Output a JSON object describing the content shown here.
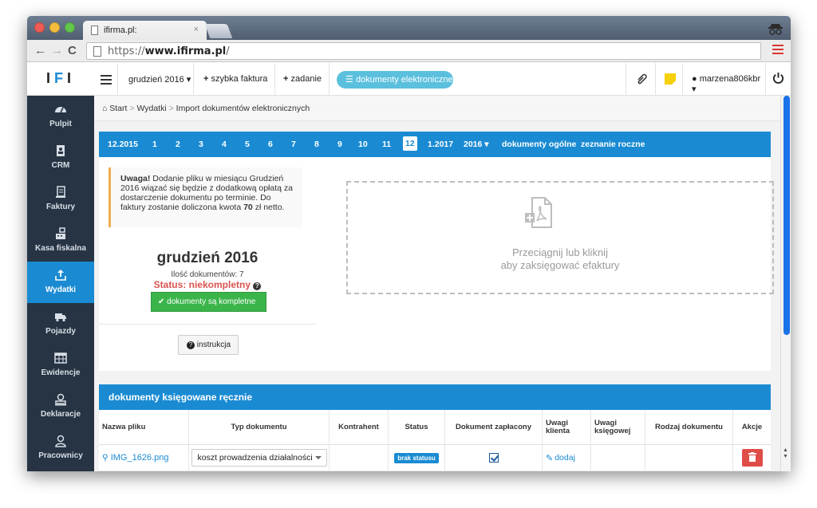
{
  "browser": {
    "tab_title": "ifirma.pl:",
    "tab_close": "×",
    "url_scheme": "https://",
    "url_host": "www.ifirma.pl",
    "url_path": "/"
  },
  "logo": {
    "text": "IFI"
  },
  "sidebar": {
    "items": [
      {
        "label": "Pulpit",
        "icon": "dashboard-icon"
      },
      {
        "label": "CRM",
        "icon": "contacts-icon"
      },
      {
        "label": "Faktury",
        "icon": "invoice-icon"
      },
      {
        "label": "Kasa fiskalna",
        "icon": "cash-register-icon"
      },
      {
        "label": "Wydatki",
        "icon": "upload-icon",
        "active": true
      },
      {
        "label": "Pojazdy",
        "icon": "truck-icon"
      },
      {
        "label": "Ewidencje",
        "icon": "table-icon"
      },
      {
        "label": "Deklaracje",
        "icon": "stamp-icon"
      },
      {
        "label": "Pracownicy",
        "icon": "person-icon"
      }
    ]
  },
  "appbar": {
    "month": "grudzień 2016",
    "quick_invoice": "szybka faktura",
    "task": "zadanie",
    "edocs": "dokumenty elektroniczne",
    "user": "marzena806kbr"
  },
  "breadcrumb": {
    "start": "Start",
    "expenses": "Wydatki",
    "current": "Import dokumentów elektronicznych"
  },
  "months": [
    "12.2015",
    "1",
    "2",
    "3",
    "4",
    "5",
    "6",
    "7",
    "8",
    "9",
    "10",
    "11",
    "12",
    "1.2017",
    "2016",
    "dokumenty ogólne",
    "zeznanie roczne"
  ],
  "warning": {
    "bold": "Uwaga!",
    "text1": " Dodanie pliku w miesiącu Grudzień 2016 wiązać się będzie z dodatkową opłatą za dostarczenie dokumentu po terminie. Do faktury zostanie doliczona kwota ",
    "amount": "70",
    "text2": " zł netto."
  },
  "summary": {
    "title": "grudzień 2016",
    "doc_count": "Ilość dokumentów: 7",
    "status": "Status: niekompletny",
    "complete_button": "dokumenty są kompletne",
    "instruction_button": "instrukcja"
  },
  "dropzone": {
    "line1": "Przeciągnij lub kliknij",
    "line2": "aby zaksięgować efaktury"
  },
  "table": {
    "title": "dokumenty księgowane ręcznie",
    "headers": [
      "Nazwa pliku",
      "Typ dokumentu",
      "Kontrahent",
      "Status",
      "Dokument zapłacony",
      "Uwagi klienta",
      "Uwagi księgowej",
      "Rodzaj dokumentu",
      "Akcje"
    ],
    "rows": [
      {
        "file": "IMG_1626.png",
        "type": "koszt prowadzenia działalności",
        "contractor": "",
        "status": "brak statusu",
        "paid": true,
        "client_notes": "dodaj",
        "accountant_notes": "",
        "doc_kind": ""
      }
    ]
  },
  "colors": {
    "brand": "#1a8bd3",
    "sidebar_bg": "#263444",
    "success": "#3bb54a",
    "danger": "#d9534f",
    "warning_border": "#f0ad4e"
  }
}
